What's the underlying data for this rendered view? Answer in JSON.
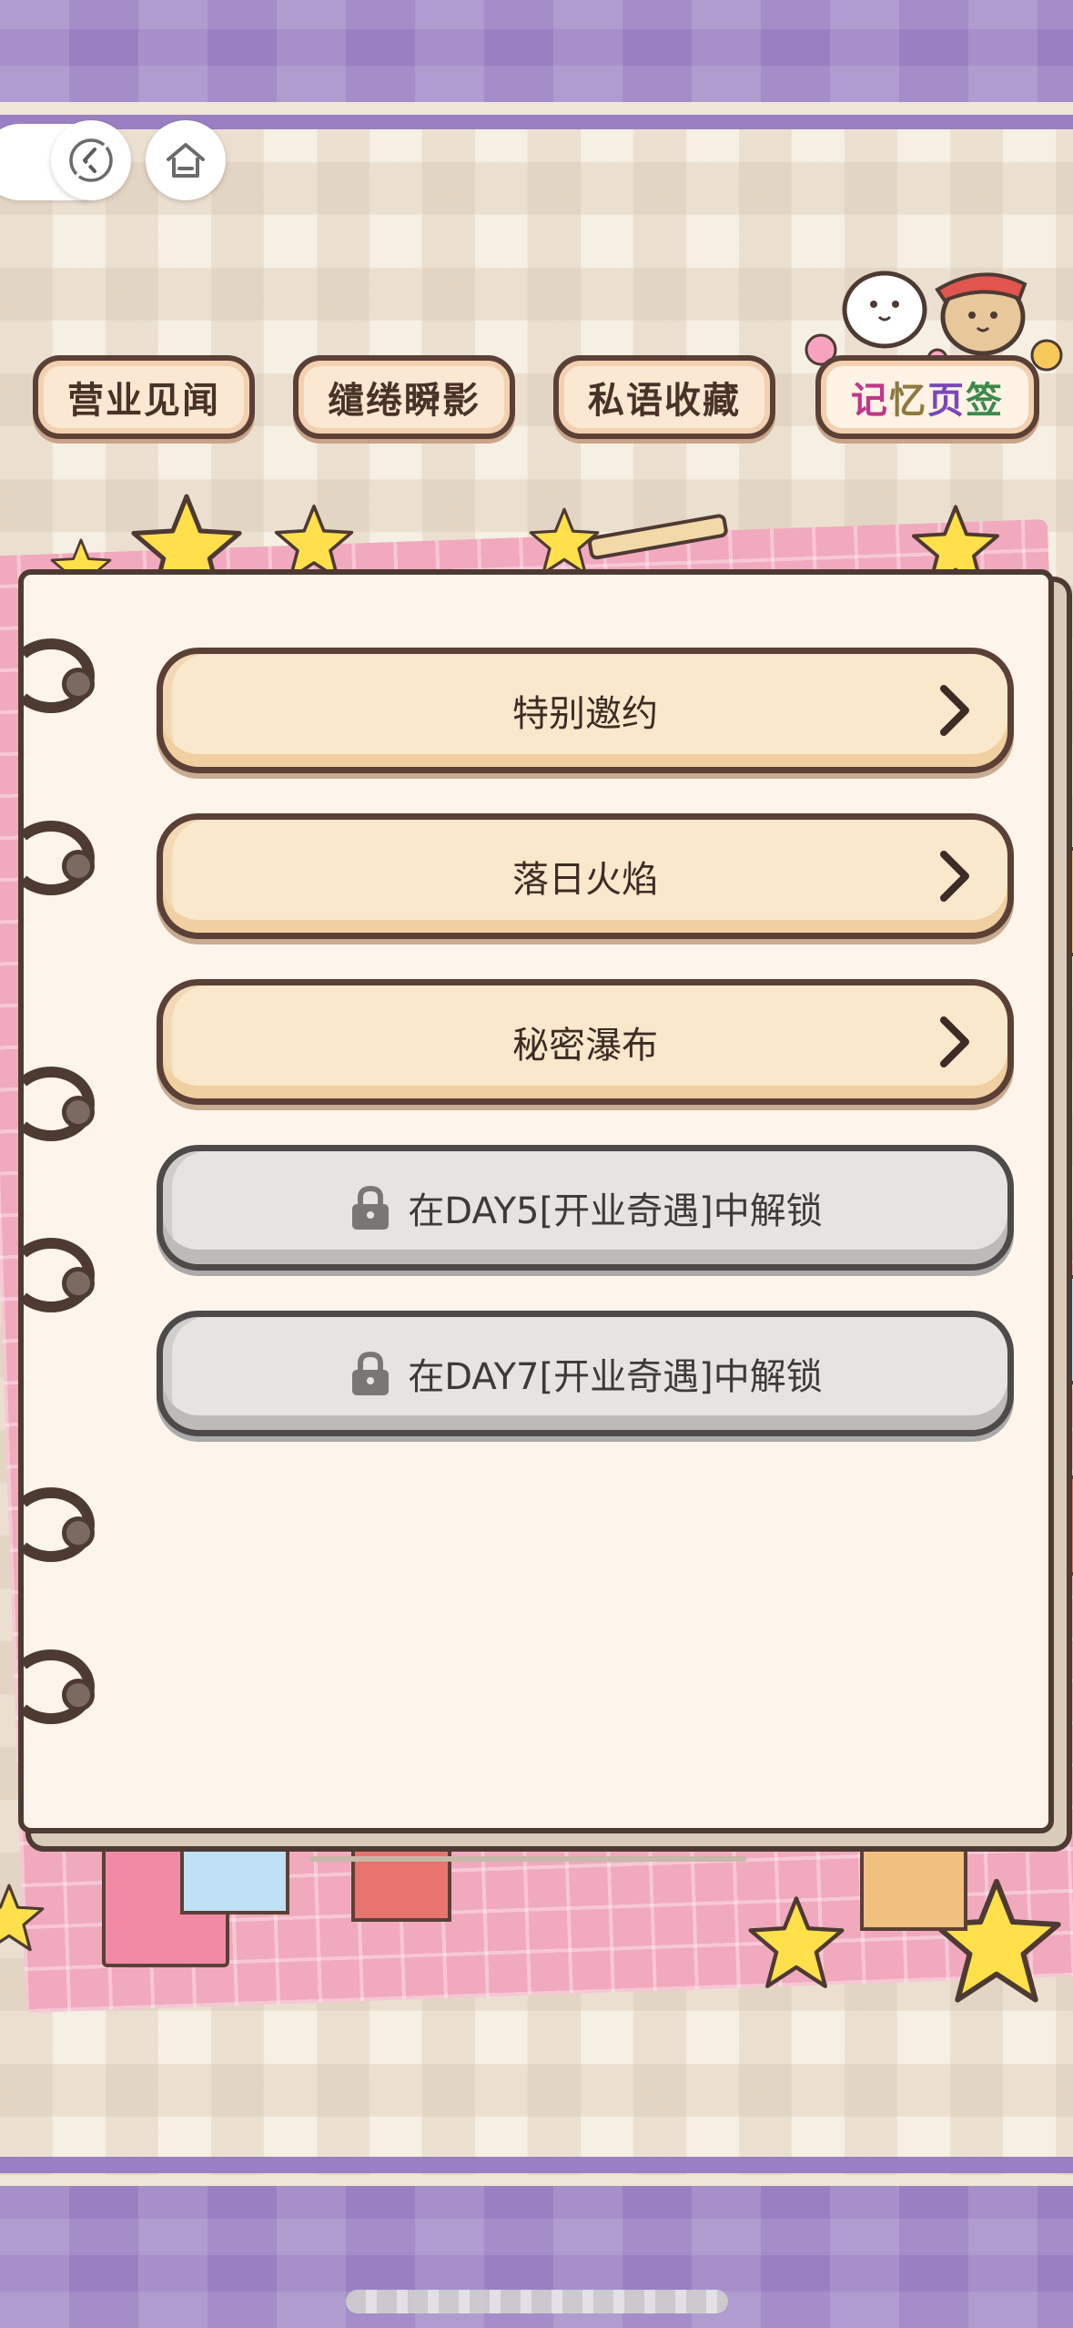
{
  "nav": {
    "back_label": "back",
    "home_label": "home"
  },
  "tabs": [
    {
      "label": "营业见闻",
      "active": false
    },
    {
      "label": "缱绻瞬影",
      "active": false
    },
    {
      "label": "私语收藏",
      "active": false
    },
    {
      "label": "记忆页签",
      "active": true,
      "chars": [
        "记",
        "忆",
        "页",
        "签"
      ]
    }
  ],
  "menu": [
    {
      "label": "特别邀约",
      "locked": false
    },
    {
      "label": "落日火焰",
      "locked": false
    },
    {
      "label": "秘密瀑布",
      "locked": false
    },
    {
      "label": "在DAY5[开业奇遇]中解锁",
      "locked": true
    },
    {
      "label": "在DAY7[开业奇遇]中解锁",
      "locked": true
    }
  ],
  "colors": {
    "accent_purple": "#9a80c2",
    "button_cream": "#fae8cc",
    "locked_gray": "#e6e4e3",
    "outline_brown": "#5a4036",
    "mat_pink": "#f1a9be"
  },
  "icons": [
    "back-icon",
    "home-icon",
    "chevron-right-icon",
    "lock-icon",
    "star-icon"
  ]
}
